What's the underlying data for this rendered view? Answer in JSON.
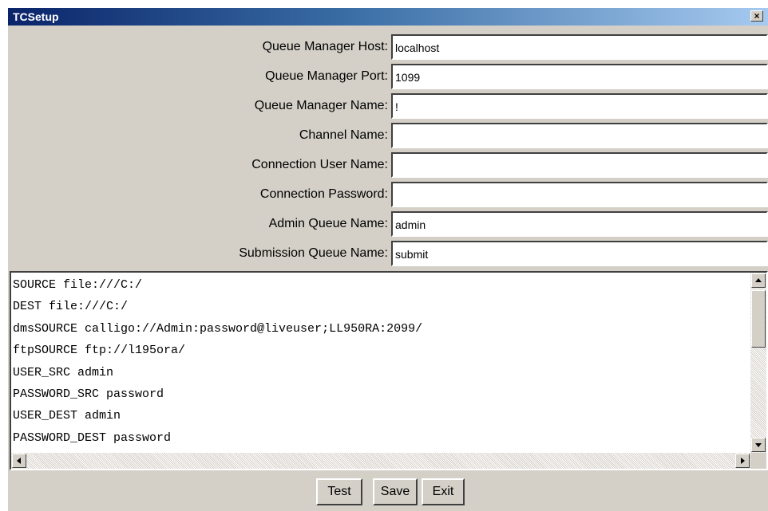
{
  "window": {
    "title": "TCSetup",
    "close_label": "×"
  },
  "form": {
    "fields": [
      {
        "label": "Queue Manager Host:",
        "value": "localhost"
      },
      {
        "label": "Queue Manager Port:",
        "value": "1099"
      },
      {
        "label": "Queue Manager Name:",
        "value": "!"
      },
      {
        "label": "Channel Name:",
        "value": ""
      },
      {
        "label": "Connection User Name:",
        "value": ""
      },
      {
        "label": "Connection Password:",
        "value": ""
      },
      {
        "label": "Admin Queue Name:",
        "value": "admin"
      },
      {
        "label": "Submission Queue Name:",
        "value": "submit"
      }
    ]
  },
  "config_text": {
    "lines": [
      "SOURCE file:///C:/",
      "DEST file:///C:/",
      "dmsSOURCE calligo://Admin:password@liveuser;LL950RA:2099/",
      "ftpSOURCE ftp://l195ora/",
      "USER_SRC admin",
      "PASSWORD_SRC password",
      "USER_DEST admin",
      "PASSWORD_DEST password"
    ]
  },
  "buttons": {
    "test": "Test",
    "save": "Save",
    "exit": "Exit"
  },
  "icons": {
    "close": "close-icon",
    "scroll_up": "arrow-up-icon",
    "scroll_down": "arrow-down-icon",
    "scroll_left": "arrow-left-icon",
    "scroll_right": "arrow-right-icon"
  },
  "colors": {
    "titlebar_start": "#0a246a",
    "titlebar_end": "#a6caf0",
    "face": "#d4d0c8"
  }
}
